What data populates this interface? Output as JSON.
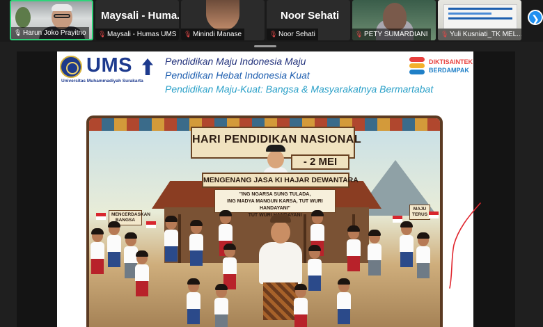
{
  "participants": [
    {
      "name": "Harun Joko Prayitno",
      "mic": "on",
      "active": true
    },
    {
      "name": "Maysali - Humas UMS",
      "display_name": "Maysali  -  Huma...",
      "mic": "muted"
    },
    {
      "name": "Minindi Manase",
      "mic": "muted"
    },
    {
      "name": "Noor Sehati",
      "display_name": "Noor Sehati",
      "mic": "muted"
    },
    {
      "name": "PETY SUMARDIANI",
      "mic": "muted"
    },
    {
      "name": "Yuli Kusniati_TK MEL...",
      "mic": "muted"
    }
  ],
  "next_button": {
    "icon": "chevron-right-icon",
    "glyph": "❯"
  },
  "slide": {
    "logo": {
      "word": "UMS",
      "subtitle": "Universitas Muhammadiyah Surakarta"
    },
    "mottos": [
      "Pendidikan Maju Indonesia Maju",
      "Pendidikan Hebat Indonesia Kuat",
      "Pendidikan Maju-Kuat: Bangsa & Masyarakatnya Bermartabat"
    ],
    "partner_logo": {
      "line1": "DIKTISAINTEK",
      "line2": "BERDAMPAK"
    },
    "poster": {
      "banner_title": "HARI PENDIDIKAN NASIONAL",
      "banner_date": "- 2 MEI",
      "ribbon": "MENGENANG JASA KI HAJAR DEWANTARA",
      "quote": "\"ING NGARSA SUNG TULADA,\nING MADYA MANGUN KARSA, TUT WURI HANDAYANI\"\nTUT WURI HANDAYANI",
      "sign_left": "MENCERDASKAN BANGSA",
      "sign_right": "MAJU TERUS"
    }
  },
  "colors": {
    "active_border": "#2fd47a",
    "muted_mic": "#e04848",
    "brand_blue": "#1d3a8e",
    "annotation": "#e0262e"
  }
}
